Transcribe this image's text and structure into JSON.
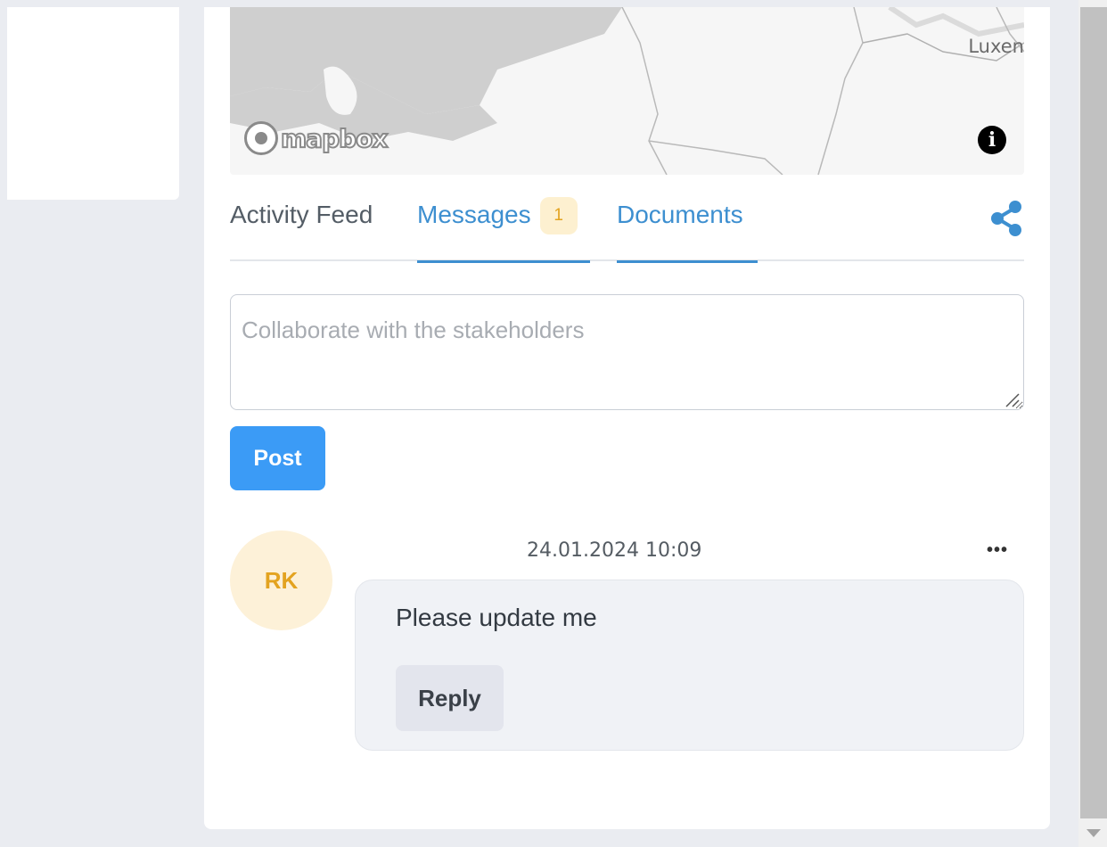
{
  "map": {
    "place_label": "Luxen",
    "attribution_logo": "mapbox",
    "info_icon": "info-icon"
  },
  "tabs": [
    {
      "label": "Activity Feed",
      "active": false
    },
    {
      "label": "Messages",
      "badge": "1",
      "active": true
    },
    {
      "label": "Documents",
      "active": true
    }
  ],
  "share_icon": "share-icon",
  "composer": {
    "placeholder": "Collaborate with the stakeholders",
    "post_label": "Post"
  },
  "message": {
    "avatar_initials": "RK",
    "timestamp": "24.01.2024 10:09",
    "more_icon": "more-icon",
    "text": "Please update me",
    "reply_label": "Reply"
  },
  "colors": {
    "accent": "#3d8fd0",
    "post_button": "#3b9bf6",
    "badge_bg": "#fdf0d0",
    "badge_text": "#e3a320",
    "avatar_bg": "#fdf1d8"
  }
}
